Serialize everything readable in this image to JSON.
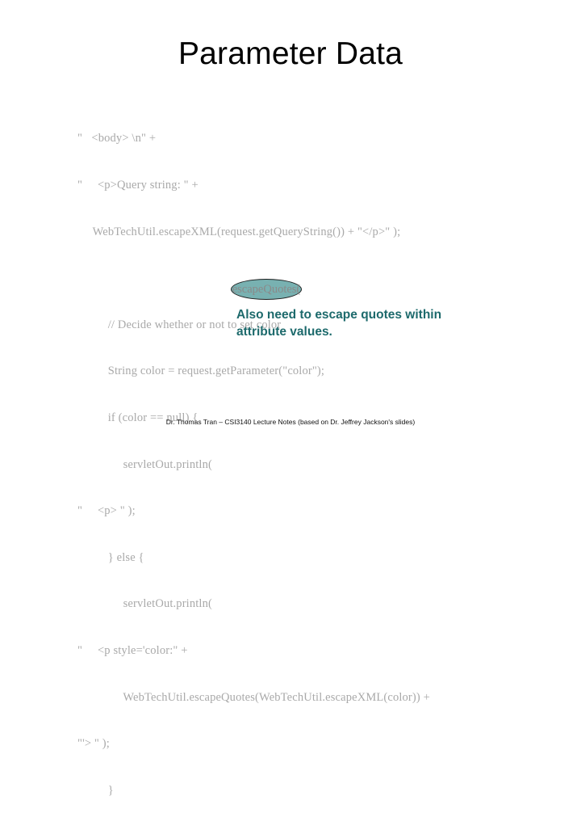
{
  "slide": {
    "title": "Parameter Data",
    "background_color": "#ffffff"
  },
  "code": {
    "text_color": "#a9a9a9",
    "lines": [
      "\"   <body> \\n\" +",
      "\"     <p>Query string: \" +",
      "     WebTechUtil.escapeXML(request.getQueryString()) + \"</p>\" );",
      "",
      "          // Decide whether or not to set color",
      "          String color = request.getParameter(\"color\");",
      "          if (color == null) {",
      "               servletOut.println(",
      "\"     <p> \" );",
      "          } else {",
      "               servletOut.println(",
      "\"     <p style='color:\" +",
      "               WebTechUtil.escapeQuotes(WebTechUtil.escapeXML(color)) +",
      "\"'> \" );",
      "          }"
    ]
  },
  "highlight": {
    "label": "escapeQuotes(",
    "fill_color": "#78b1b1",
    "outline_color": "#1f1f1f"
  },
  "annotation": {
    "line1": "Also need to escape quotes within",
    "line2": "attribute values.",
    "color": "#1d6a6c"
  },
  "footer": {
    "text": "Dr. Thomas Tran – CSI3140 Lecture Notes (based on Dr. Jeffrey Jackson's slides)"
  }
}
